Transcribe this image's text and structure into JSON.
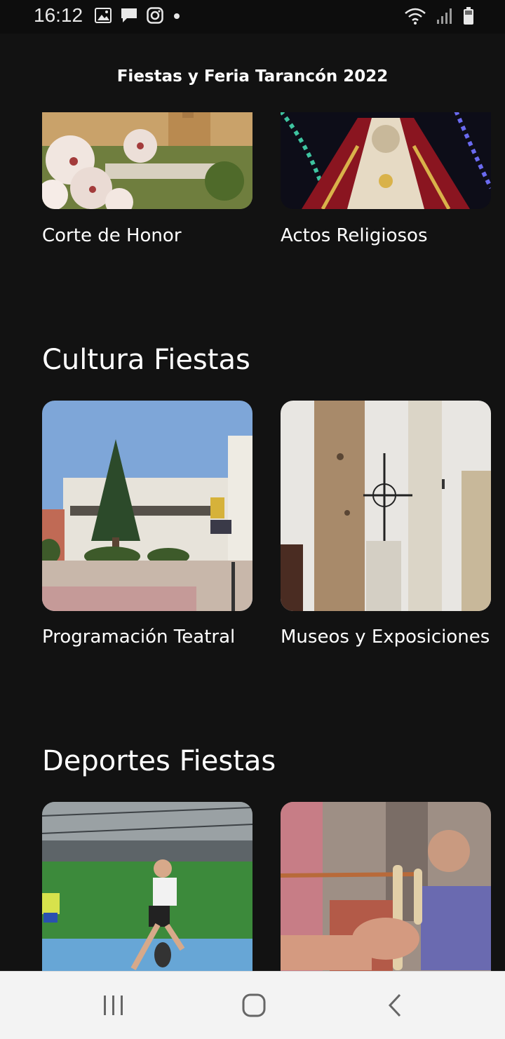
{
  "status_bar": {
    "time": "16:12",
    "left_icons": [
      "image-icon",
      "message-icon",
      "instagram-icon",
      "dot-icon"
    ],
    "right_icons": [
      "wifi-icon",
      "signal-icon",
      "battery-icon"
    ]
  },
  "header": {
    "title": "Fiestas y Feria Tarancón 2022"
  },
  "sections": [
    {
      "title": "",
      "items": [
        {
          "label": "Corte de Honor",
          "image": "almond-blossom-town-image"
        },
        {
          "label": "Actos Religiosos",
          "image": "virgin-statue-image"
        }
      ]
    },
    {
      "title": "Cultura Fiestas",
      "items": [
        {
          "label": "Programación Teatral",
          "image": "theatre-building-image"
        },
        {
          "label": "Museos y Exposiciones",
          "image": "stone-columns-image"
        }
      ]
    },
    {
      "title": "Deportes Fiestas",
      "items": [
        {
          "label": "",
          "image": "padel-player-image"
        },
        {
          "label": "",
          "image": "slingshot-image"
        }
      ]
    }
  ],
  "nav_bar": {
    "buttons": [
      "recent-apps-icon",
      "home-icon",
      "back-icon"
    ]
  }
}
